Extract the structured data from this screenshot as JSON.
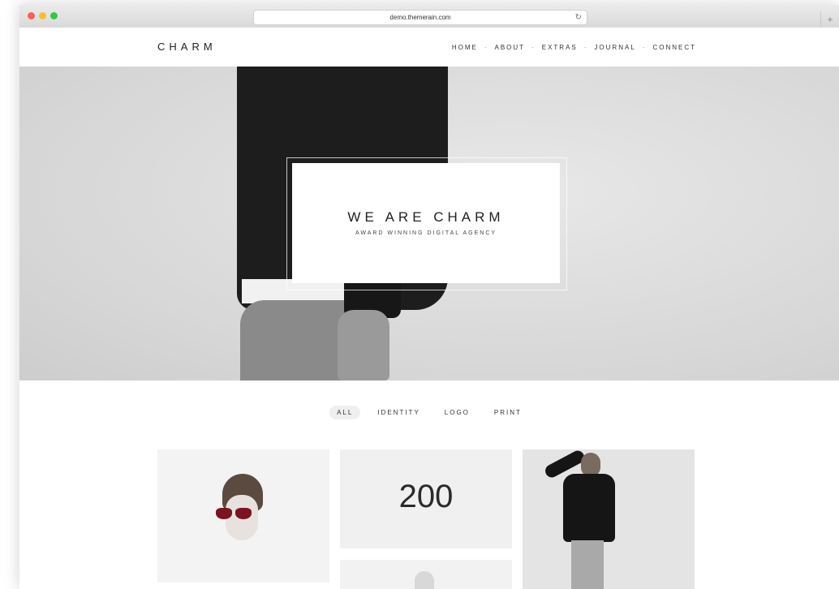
{
  "browser": {
    "url": "demo.themerain.com",
    "reload_glyph": "↻",
    "newtab_glyph": "+"
  },
  "site": {
    "logo": "CHARM",
    "nav": [
      "HOME",
      "ABOUT",
      "EXTRAS",
      "JOURNAL",
      "CONNECT"
    ],
    "nav_separator": "·"
  },
  "hero": {
    "title": "WE ARE CHARM",
    "subtitle": "AWARD WINNING DIGITAL AGENCY"
  },
  "filters": {
    "items": [
      "ALL",
      "IDENTITY",
      "LOGO",
      "PRINT"
    ],
    "active": "ALL"
  },
  "portfolio": {
    "tile2_text": "200"
  },
  "colors": {
    "traffic_red": "#fc5f57",
    "traffic_yellow": "#fdbc2e",
    "traffic_green": "#33c748",
    "glasses": "#7a1420"
  }
}
